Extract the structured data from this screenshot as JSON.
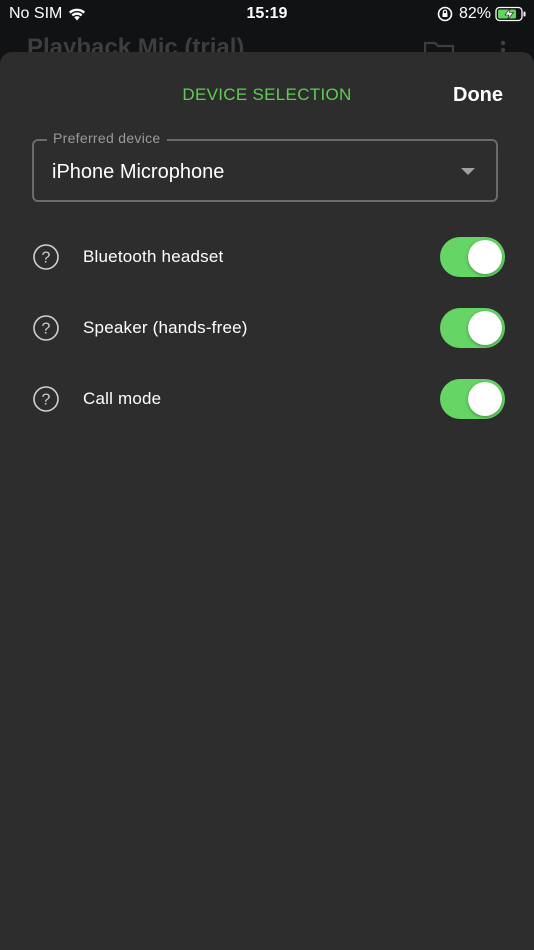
{
  "status_bar": {
    "carrier": "No SIM",
    "time": "15:19",
    "battery_percent": "82%",
    "icons": [
      "wifi-icon",
      "orientation-lock-icon",
      "battery-charging-icon"
    ]
  },
  "background_app": {
    "title": "Playback Mic (trial)",
    "icons": [
      "folder-icon",
      "more-vertical-icon"
    ]
  },
  "sheet": {
    "title": "DEVICE SELECTION",
    "done_label": "Done",
    "preferred_device": {
      "label": "Preferred device",
      "value": "iPhone Microphone"
    },
    "options": [
      {
        "label": "Bluetooth headset",
        "enabled": true
      },
      {
        "label": "Speaker (hands-free)",
        "enabled": true
      },
      {
        "label": "Call mode",
        "enabled": true
      }
    ]
  },
  "colors": {
    "accent": "#5fcd55",
    "toggle_on": "#65d565",
    "sheet_background": "#2d2d2d",
    "page_background": "#111213"
  }
}
